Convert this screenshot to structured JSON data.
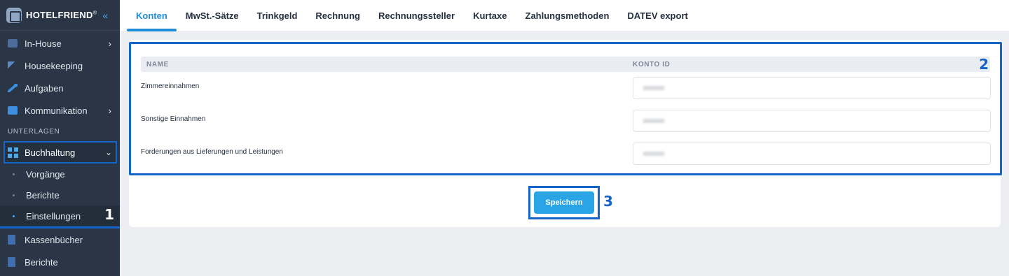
{
  "brand": {
    "name": "HOTELFRIEND",
    "mark": "®",
    "collapse_icon": "double-chevron-left-icon"
  },
  "sidebar": {
    "items_top": [
      {
        "label": "In-House",
        "icon": "cart-icon",
        "has_chevron": true
      },
      {
        "label": "Housekeeping",
        "icon": "broom-icon"
      },
      {
        "label": "Aufgaben",
        "icon": "wrench-icon"
      },
      {
        "label": "Kommunikation",
        "icon": "chat-icon",
        "has_chevron": true
      }
    ],
    "section_label": "UNTERLAGEN",
    "active_group": {
      "label": "Buchhaltung",
      "icon": "grid-icon",
      "chevron": "⌄"
    },
    "sub_items": [
      "Vorgänge",
      "Berichte",
      "Einstellungen"
    ],
    "items_bottom": [
      {
        "label": "Kassenbücher",
        "icon": "book-icon"
      },
      {
        "label": "Berichte",
        "icon": "clipboard-icon"
      }
    ],
    "callout": "1"
  },
  "tabs": [
    {
      "label": "Konten",
      "active": true
    },
    {
      "label": "MwSt.-Sätze"
    },
    {
      "label": "Trinkgeld"
    },
    {
      "label": "Rechnung"
    },
    {
      "label": "Rechnungssteller"
    },
    {
      "label": "Kurtaxe"
    },
    {
      "label": "Zahlungsmethoden"
    },
    {
      "label": "DATEV export"
    }
  ],
  "table": {
    "headers": {
      "name": "NAME",
      "konto_id": "KONTO ID"
    },
    "rows": [
      {
        "label": "Zimmereinnahmen"
      },
      {
        "label": "Sonstige Einnahmen"
      },
      {
        "label": "Forderungen aus Lieferungen und Leistungen"
      }
    ],
    "callout": "2"
  },
  "actions": {
    "save_label": "Speichern",
    "callout": "3"
  },
  "colors": {
    "sidebar_bg": "#2a3646",
    "accent": "#1e8ed8",
    "highlight_frame": "#1565c8",
    "button": "#2ba4e6"
  }
}
